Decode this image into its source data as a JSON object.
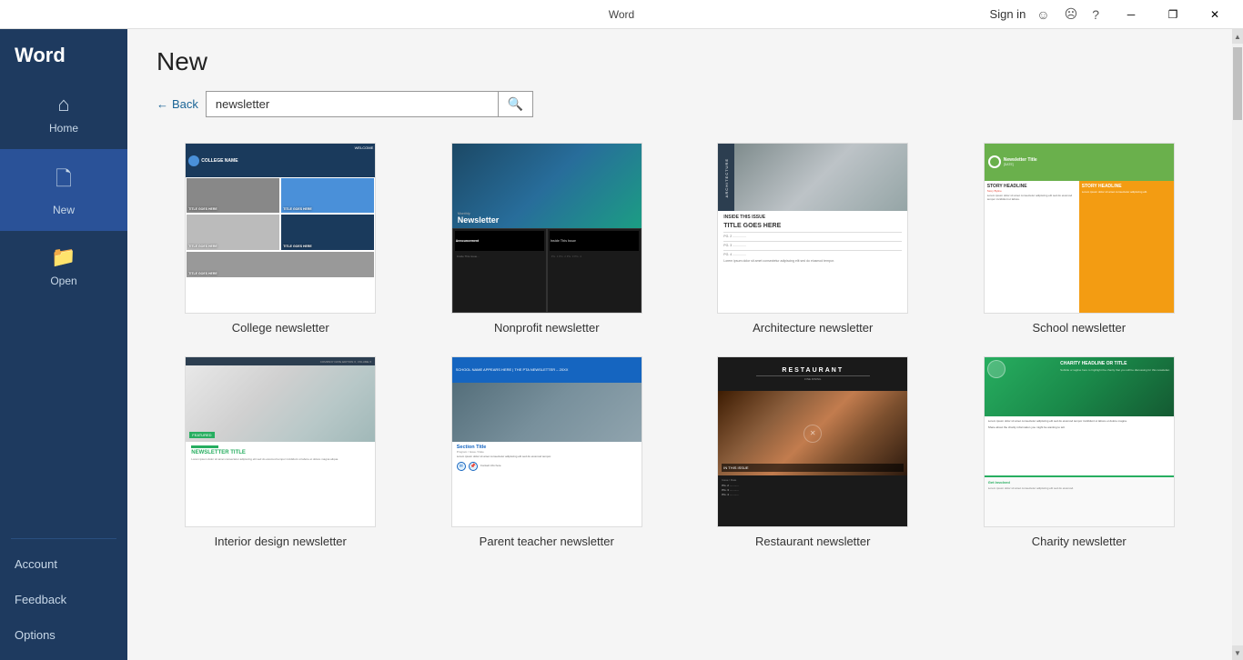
{
  "titlebar": {
    "app_name": "Word",
    "signin_label": "Sign in",
    "smile_icon": "☺",
    "frown_icon": "☹",
    "help_icon": "?",
    "minimize_icon": "─",
    "restore_icon": "❐",
    "close_icon": "✕"
  },
  "sidebar": {
    "app_title": "Word",
    "nav_items": [
      {
        "id": "home",
        "label": "Home",
        "icon": "⌂",
        "active": false
      },
      {
        "id": "new",
        "label": "New",
        "icon": "🗋",
        "active": true
      },
      {
        "id": "open",
        "label": "Open",
        "icon": "📁",
        "active": false
      }
    ],
    "bottom_items": [
      {
        "id": "account",
        "label": "Account"
      },
      {
        "id": "feedback",
        "label": "Feedback"
      },
      {
        "id": "options",
        "label": "Options"
      }
    ]
  },
  "content": {
    "page_title": "New",
    "back_button_label": "Back",
    "search_placeholder": "newsletter",
    "search_input_value": "newsletter",
    "templates": [
      {
        "id": "college-newsletter",
        "name": "College newsletter",
        "type": "college"
      },
      {
        "id": "nonprofit-newsletter",
        "name": "Nonprofit newsletter",
        "type": "nonprofit"
      },
      {
        "id": "architecture-newsletter",
        "name": "Architecture newsletter",
        "type": "architecture"
      },
      {
        "id": "school-newsletter",
        "name": "School newsletter",
        "type": "school"
      },
      {
        "id": "interior-design-newsletter",
        "name": "Interior design newsletter",
        "type": "interior"
      },
      {
        "id": "parent-teacher-newsletter",
        "name": "Parent teacher newsletter",
        "type": "parentteacher"
      },
      {
        "id": "restaurant-newsletter",
        "name": "Restaurant newsletter",
        "type": "restaurant"
      },
      {
        "id": "charity-newsletter",
        "name": "Charity newsletter",
        "type": "charity"
      }
    ]
  }
}
